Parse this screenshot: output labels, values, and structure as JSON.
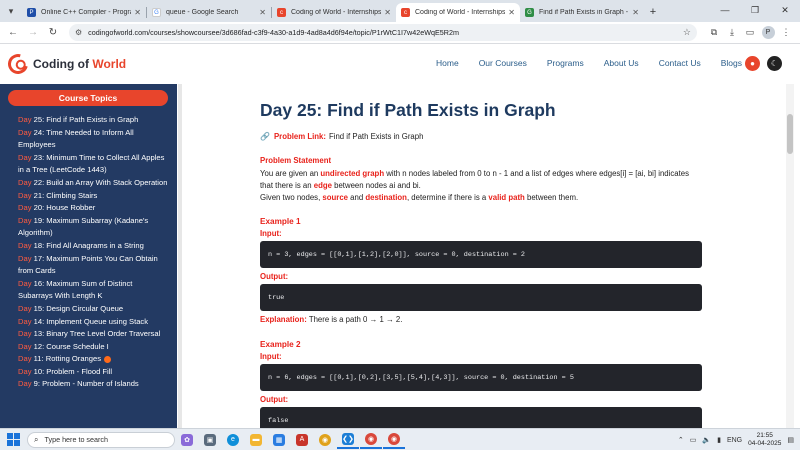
{
  "browser": {
    "tabs": [
      {
        "title": "Online C++ Compiler - Progra",
        "favicon": "gdb-icon",
        "color": "#1f4ea8",
        "active": false
      },
      {
        "title": "queue - Google Search",
        "favicon": "google-icon",
        "color": "#4285f4",
        "active": false
      },
      {
        "title": "Coding of World - Internships,",
        "favicon": "cow-icon",
        "color": "#e8452c",
        "active": false
      },
      {
        "title": "Coding of World - Internships,",
        "favicon": "cow-icon",
        "color": "#e8452c",
        "active": true
      },
      {
        "title": "Find if Path Exists in Graph - Ge",
        "favicon": "gfg-icon",
        "color": "#2f8d46",
        "active": false
      }
    ],
    "url": "codingofworld.com/courses/showcoursee/3d686fad-c3f9-4a30-a1d9-4ad8a4d6f94e/topic/P1rWtC1I7w42eWqE5R2m",
    "profile_initial": "P"
  },
  "site": {
    "logo_main": "Coding of ",
    "logo_accent": "World",
    "nav": [
      "Home",
      "Our Courses",
      "Programs",
      "About Us",
      "Contact Us",
      "Blogs"
    ]
  },
  "sidebar": {
    "title": "Course Topics",
    "items": [
      {
        "day": "Day",
        "text": " 25: Find if Path Exists in Graph"
      },
      {
        "day": "Day",
        "text": " 24: Time Needed to Inform All Employees"
      },
      {
        "day": "Day",
        "text": " 23: Minimum Time to Collect All Apples in a Tree (LeetCode 1443)"
      },
      {
        "day": "Day",
        "text": " 22: Build an Array With Stack Operation"
      },
      {
        "day": "Day",
        "text": " 21: Climbing Stairs"
      },
      {
        "day": "Day",
        "text": " 20: House Robber"
      },
      {
        "day": "Day",
        "text": " 19: Maximum Subarray (Kadane's Algorithm)"
      },
      {
        "day": "Day",
        "text": " 18: Find All Anagrams in a String"
      },
      {
        "day": "Day",
        "text": " 17: Maximum Points You Can Obtain from Cards"
      },
      {
        "day": "Day",
        "text": " 16: Maximum Sum of Distinct Subarrays With Length K"
      },
      {
        "day": "Day",
        "text": " 15: Design Circular Queue"
      },
      {
        "day": "Day",
        "text": " 14: Implement Queue using Stack"
      },
      {
        "day": "Day",
        "text": " 13: Binary Tree Level Order Traversal"
      },
      {
        "day": "Day",
        "text": " 12: Course Schedule I"
      },
      {
        "day": "Day",
        "text": " 11: Rotting Oranges"
      },
      {
        "day": "Day",
        "text": " 10: Problem - Flood Fill"
      },
      {
        "day": "Day",
        "text": " 9: Problem - Number of Islands"
      }
    ]
  },
  "content": {
    "title": "Day 25: Find if Path Exists in Graph",
    "problem_link_label": "Problem Link:",
    "problem_link_text": "Find if Path Exists in Graph",
    "statement_heading": "Problem Statement",
    "statement": {
      "p1": "You are given an ",
      "k1": "undirected graph",
      "p2": " with n nodes labeled from 0 to n - 1 and a list of edges where edges[i] = [ai, bi] indicates that there is an ",
      "k2": "edge",
      "p3": " between nodes ai and bi.",
      "p4": "Given two nodes, ",
      "k3": "source",
      "p5": " and ",
      "k4": "destination",
      "p6": ", determine if there is a ",
      "k5": "valid path",
      "p7": " between them."
    },
    "examples": [
      {
        "heading": "Example 1",
        "input_label": "Input:",
        "input": "n = 3, edges = [[0,1],[1,2],[2,0]], source = 0, destination = 2",
        "output_label": "Output:",
        "output": "true",
        "explanation_label": "Explanation:",
        "explanation": "There is a path 0 → 1 → 2."
      },
      {
        "heading": "Example 2",
        "input_label": "Input:",
        "input": "n = 6, edges = [[0,1],[0,2],[3,5],[5,4],[4,3]], source = 0, destination = 5",
        "output_label": "Output:",
        "output": "false"
      }
    ]
  },
  "taskbar": {
    "search_placeholder": "Type here to search",
    "language": "ENG",
    "time": "21:55",
    "date": "04-04-2025"
  }
}
